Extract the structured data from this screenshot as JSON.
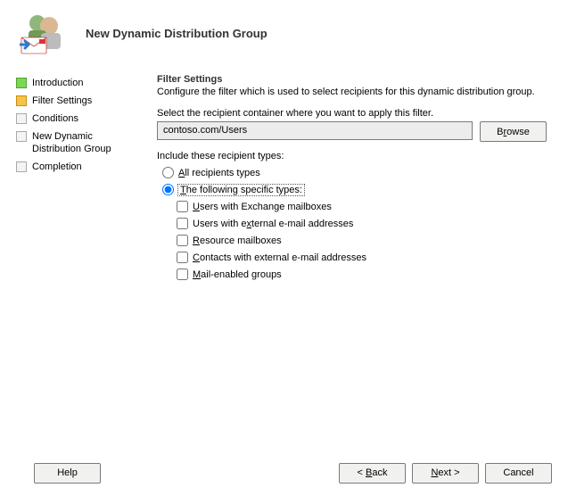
{
  "header": {
    "title": "New Dynamic Distribution Group"
  },
  "sidebar": {
    "items": [
      {
        "label": "Introduction",
        "state": "completed"
      },
      {
        "label": "Filter Settings",
        "state": "current"
      },
      {
        "label": "Conditions",
        "state": "pending"
      },
      {
        "label": "New Dynamic Distribution Group",
        "state": "pending"
      },
      {
        "label": "Completion",
        "state": "pending"
      }
    ]
  },
  "main": {
    "title": "Filter Settings",
    "description": "Configure the filter which is used to select recipients for this dynamic distribution group.",
    "container_label": "Select the recipient container where you want to apply this filter.",
    "container_value": "contoso.com/Users",
    "browse_label": "Browse",
    "include_label": "Include these recipient types:",
    "radio_all": "All recipients types",
    "radio_specific": "The following specific types:",
    "checks": {
      "exchange": "sers with Exchange mailboxes",
      "external_users": "Users with e",
      "external_users2": "xternal e-mail addresses",
      "resource": "esource mailboxes",
      "contacts": "ontacts with external e-mail addresses",
      "mailgroups": "ail-enabled groups"
    }
  },
  "footer": {
    "help": "Help",
    "back": "< Back",
    "next": "Next >",
    "cancel": "Cancel"
  }
}
